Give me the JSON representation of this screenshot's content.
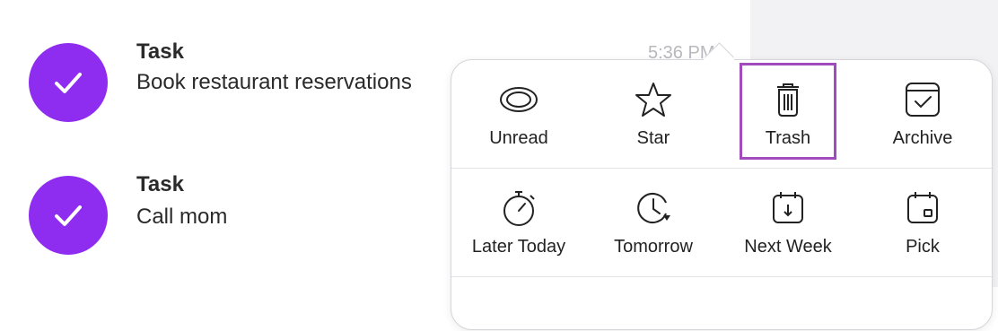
{
  "tasks": [
    {
      "title": "Task",
      "subtitle": "Book restaurant reservations",
      "time": "5:36 PM"
    },
    {
      "title": "Task",
      "subtitle": "Call mom"
    }
  ],
  "menu": {
    "row1": [
      {
        "label": "Unread",
        "icon": "eye-icon"
      },
      {
        "label": "Star",
        "icon": "star-icon"
      },
      {
        "label": "Trash",
        "icon": "trash-icon"
      },
      {
        "label": "Archive",
        "icon": "archive-icon"
      }
    ],
    "row2": [
      {
        "label": "Later Today",
        "icon": "timer-icon"
      },
      {
        "label": "Tomorrow",
        "icon": "clock-forward-icon"
      },
      {
        "label": "Next Week",
        "icon": "calendar-down-icon"
      },
      {
        "label": "Pick",
        "icon": "calendar-pick-icon"
      }
    ]
  },
  "colors": {
    "accent": "#8e2cf0",
    "highlight": "#a24bbf",
    "muted_time": "#b8b8bd"
  }
}
